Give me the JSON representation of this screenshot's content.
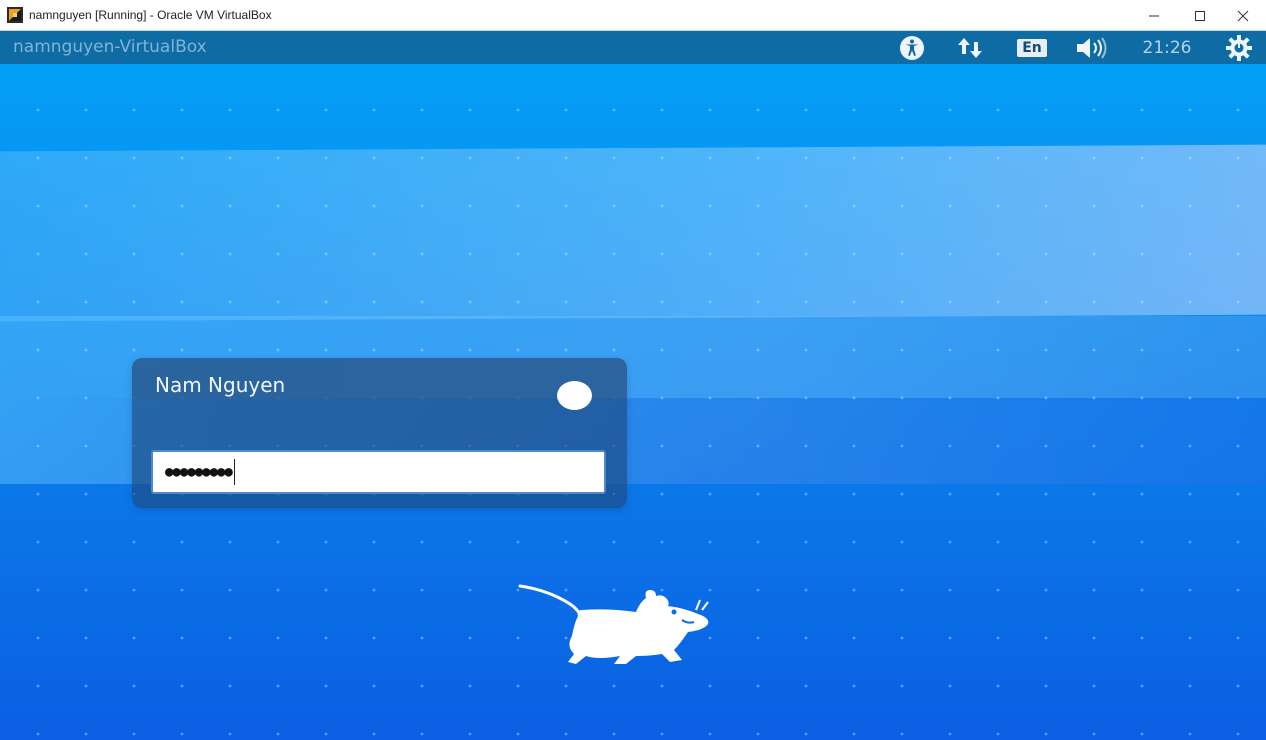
{
  "window": {
    "title": "namnguyen [Running] - Oracle VM VirtualBox",
    "icon": "virtualbox-icon",
    "controls": [
      "minimize-icon",
      "maximize-icon",
      "close-icon"
    ]
  },
  "panel": {
    "hostname": "namnguyen-VirtualBox",
    "indicators": {
      "accessibility_icon": "accessibility-icon",
      "network_icon": "network-updown-icon",
      "keyboard_layout": "En",
      "volume_icon": "volume-icon",
      "clock": "21:26",
      "power_icon": "power-gear-icon"
    },
    "colors": {
      "panel": "#0f6ba3",
      "text": "#b7d3e8"
    }
  },
  "login": {
    "user_name": "Nam Nguyen",
    "password_masked": "●●●●●●●●●",
    "session_indicator": "session-toggle"
  },
  "desktop": {
    "logo": "xfce-mouse-logo",
    "colors": {
      "top": "#039ff6",
      "bottom": "#0b5fe3"
    }
  }
}
